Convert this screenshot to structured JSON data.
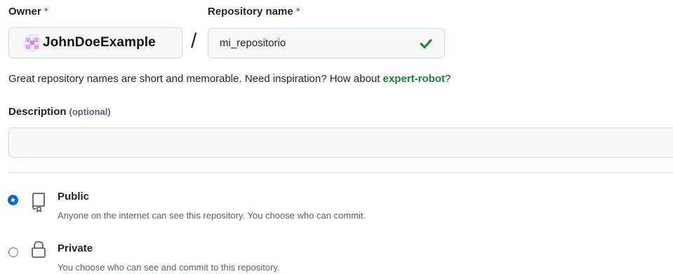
{
  "owner": {
    "label": "Owner",
    "required_mark": "*",
    "selected": "JohnDoeExample"
  },
  "separator": "/",
  "repository_name": {
    "label": "Repository name",
    "required_mark": "*",
    "value": "mi_repositorio",
    "status": "valid"
  },
  "hint": {
    "text": "Great repository names are short and memorable. Need inspiration? How about ",
    "suggestion": "expert-robot",
    "suffix": "?"
  },
  "description": {
    "label": "Description",
    "optional_note": "(optional)",
    "value": ""
  },
  "visibility": {
    "options": [
      {
        "title": "Public",
        "description": "Anyone on the internet can see this repository. You choose who can commit.",
        "icon": "repo-icon",
        "selected": true
      },
      {
        "title": "Private",
        "description": "You choose who can see and commit to this repository.",
        "icon": "lock-icon",
        "selected": false
      }
    ]
  },
  "colors": {
    "required": "#cf222e",
    "accent": "#0969da",
    "success": "#1a7f37"
  }
}
